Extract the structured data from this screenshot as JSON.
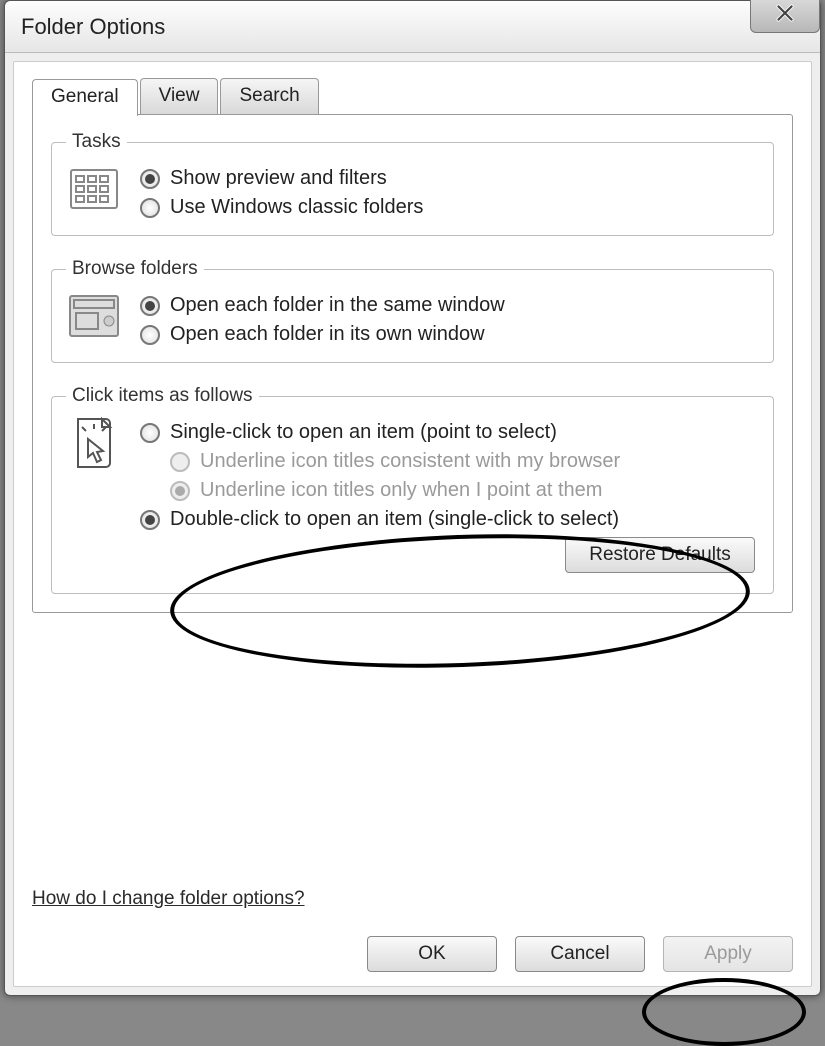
{
  "window": {
    "title": "Folder Options"
  },
  "tabs": {
    "general": "General",
    "view": "View",
    "search": "Search",
    "active": "general"
  },
  "groups": {
    "tasks": {
      "legend": "Tasks",
      "opt1": "Show preview and filters",
      "opt2": "Use Windows classic folders",
      "selected": 0
    },
    "browse": {
      "legend": "Browse folders",
      "opt1": "Open each folder in the same window",
      "opt2": "Open each folder in its own window",
      "selected": 0
    },
    "click": {
      "legend": "Click items as follows",
      "opt1": "Single-click to open an item (point to select)",
      "sub1": "Underline icon titles consistent with my browser",
      "sub2": "Underline icon titles only when I point at them",
      "opt2": "Double-click to open an item (single-click to select)",
      "selected": 1,
      "sub_selected": 1
    }
  },
  "buttons": {
    "restore": "Restore Defaults",
    "ok": "OK",
    "cancel": "Cancel",
    "apply": "Apply"
  },
  "help_link": "How do I change folder options?"
}
